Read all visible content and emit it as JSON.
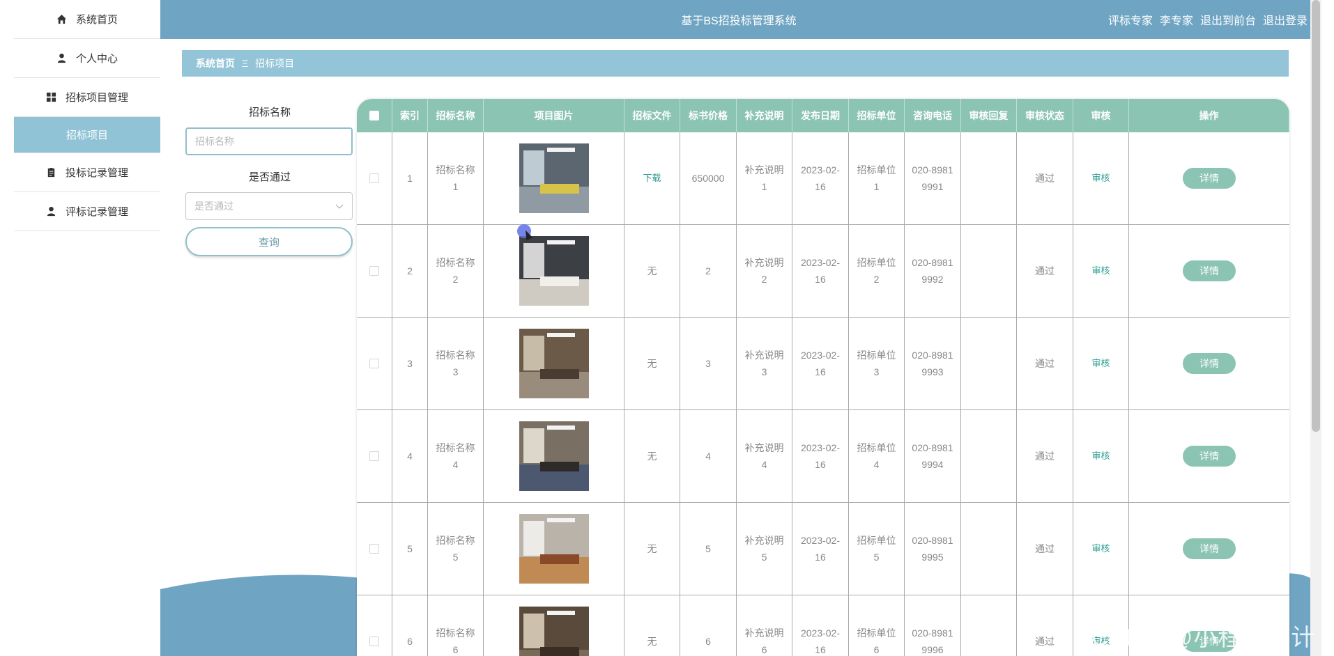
{
  "app": {
    "title": "基于BS招投标管理系统",
    "user_role": "评标专家",
    "user_name": "李专家",
    "exit_front": "退出到前台",
    "logout": "退出登录"
  },
  "sidebar": {
    "items": [
      {
        "label": "系统首页",
        "icon": "home-icon"
      },
      {
        "label": "个人中心",
        "icon": "user-icon"
      },
      {
        "label": "招标项目管理",
        "icon": "grid-icon"
      },
      {
        "label": "招标项目",
        "icon": "",
        "active": true
      },
      {
        "label": "投标记录管理",
        "icon": "clipboard-icon"
      },
      {
        "label": "评标记录管理",
        "icon": "user-icon"
      }
    ]
  },
  "breadcrumb": {
    "home": "系统首页",
    "separator": "Ξ",
    "current": "招标项目"
  },
  "search": {
    "name_label": "招标名称",
    "name_placeholder": "招标名称",
    "pass_label": "是否通过",
    "pass_placeholder": "是否通过",
    "query_button": "查询"
  },
  "table": {
    "headers": [
      "索引",
      "招标名称",
      "项目图片",
      "招标文件",
      "标书价格",
      "补充说明",
      "发布日期",
      "招标单位",
      "咨询电话",
      "审核回复",
      "审核状态",
      "审核",
      "操作"
    ],
    "rows": [
      {
        "index": "1",
        "name": "招标名称1",
        "file": "下载",
        "file_link": true,
        "price": "650000",
        "note": "补充说明1",
        "date": "2023-02-16",
        "unit": "招标单位1",
        "tel": "020-89819991",
        "reply": "",
        "status": "通过",
        "audit": "审核",
        "op": "详情"
      },
      {
        "index": "2",
        "name": "招标名称2",
        "file": "无",
        "file_link": false,
        "price": "2",
        "note": "补充说明2",
        "date": "2023-02-16",
        "unit": "招标单位2",
        "tel": "020-89819992",
        "reply": "",
        "status": "通过",
        "audit": "审核",
        "op": "详情"
      },
      {
        "index": "3",
        "name": "招标名称3",
        "file": "无",
        "file_link": false,
        "price": "3",
        "note": "补充说明3",
        "date": "2023-02-16",
        "unit": "招标单位3",
        "tel": "020-89819993",
        "reply": "",
        "status": "通过",
        "audit": "审核",
        "op": "详情"
      },
      {
        "index": "4",
        "name": "招标名称4",
        "file": "无",
        "file_link": false,
        "price": "4",
        "note": "补充说明4",
        "date": "2023-02-16",
        "unit": "招标单位4",
        "tel": "020-89819994",
        "reply": "",
        "status": "通过",
        "audit": "审核",
        "op": "详情"
      },
      {
        "index": "5",
        "name": "招标名称5",
        "file": "无",
        "file_link": false,
        "price": "5",
        "note": "补充说明5",
        "date": "2023-02-16",
        "unit": "招标单位5",
        "tel": "020-89819995",
        "reply": "",
        "status": "通过",
        "audit": "审核",
        "op": "详情"
      },
      {
        "index": "6",
        "name": "招标名称6",
        "file": "无",
        "file_link": false,
        "price": "6",
        "note": "补充说明6",
        "date": "2023-02-16",
        "unit": "招标单位6",
        "tel": "020-89819996",
        "reply": "",
        "status": "通过",
        "audit": "审核",
        "op": "详情"
      }
    ]
  },
  "colors": {
    "header_bg": "#6fa5c3",
    "table_header_bg": "#8cc4b4",
    "breadcrumb_bg": "#93c4d7",
    "link": "#2a9d8f"
  },
  "watermark": "CSDN @小程序设计"
}
